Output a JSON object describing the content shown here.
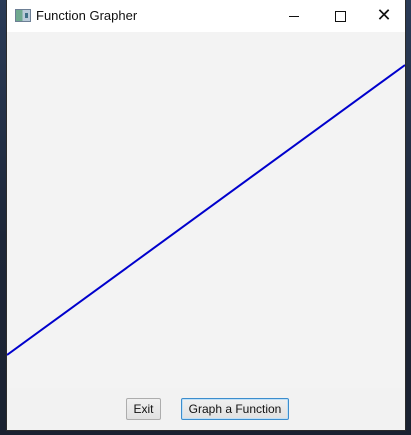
{
  "window": {
    "title": "Function Grapher"
  },
  "titlebar_buttons": {
    "minimize": "minimize",
    "maximize": "maximize",
    "close": "close"
  },
  "graph": {
    "line_color": "#0000cc",
    "background_color": "#f3f3f3"
  },
  "buttons": {
    "exit": "Exit",
    "graph_function": "Graph a Function"
  },
  "icons": {
    "app_icon": "app-window-icon",
    "minimize_icon": "minimize-icon",
    "maximize_icon": "maximize-icon",
    "close_icon": "close-icon"
  }
}
